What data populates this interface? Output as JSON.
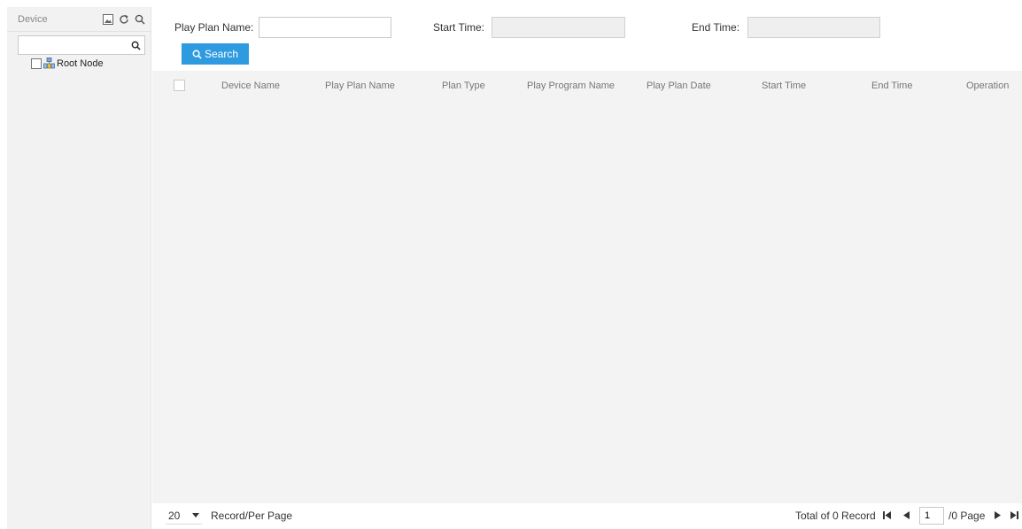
{
  "left_panel": {
    "title": "Device",
    "icons": [
      "image-icon",
      "refresh-icon",
      "search-icon"
    ],
    "search_placeholder": "",
    "tree": [
      {
        "label": "Root Node",
        "checked": false
      }
    ]
  },
  "filters": {
    "play_plan_name_label": "Play Plan Name:",
    "play_plan_name_value": "",
    "start_time_label": "Start Time:",
    "start_time_value": "",
    "end_time_label": "End Time:",
    "end_time_value": "",
    "search_button": "Search"
  },
  "table": {
    "columns": [
      "Device Name",
      "Play Plan Name",
      "Plan Type",
      "Play Program Name",
      "Play Plan Date",
      "Start Time",
      "End Time",
      "Operation"
    ],
    "rows": []
  },
  "footer": {
    "per_page_value": "20",
    "per_page_label": "Record/Per Page",
    "total_label": "Total of 0 Record",
    "current_page": "1",
    "page_label": "/0 Page"
  },
  "colors": {
    "accent": "#2e9ae0",
    "panel_bg": "#f2f2f2",
    "body_bg": "#f3f3f3"
  }
}
